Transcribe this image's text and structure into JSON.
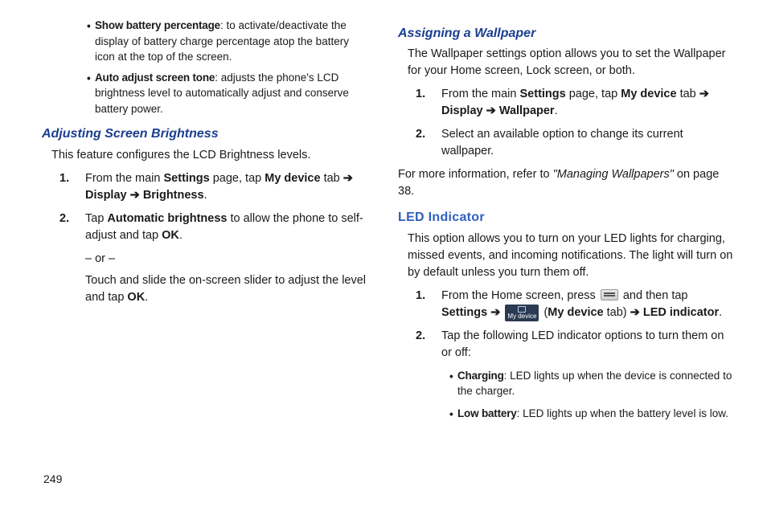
{
  "pageNumber": "249",
  "left": {
    "bullets": [
      {
        "lead": "Show battery percentage",
        "rest": ": to activate/deactivate the display of battery charge percentage atop the battery icon at the top of the screen."
      },
      {
        "lead": "Auto adjust screen tone",
        "rest": ": adjusts the phone's LCD brightness level to automatically adjust and conserve battery power."
      }
    ],
    "heading": "Adjusting Screen Brightness",
    "intro": "This feature configures the LCD Brightness levels.",
    "step1": {
      "num": "1.",
      "pre": "From the main ",
      "settings": "Settings",
      "mid1": " page, tap ",
      "mydevice": "My device",
      "mid2": " tab ",
      "arrow1": "➔",
      "display": "Display",
      "arrow2": "➔",
      "brightness": "Brightness",
      "end": "."
    },
    "step2": {
      "num": "2.",
      "pre": "Tap ",
      "auto": "Automatic brightness",
      "mid": " to allow the phone to self-adjust and tap ",
      "ok": "OK",
      "end": "."
    },
    "or": "– or –",
    "altText": {
      "pre": "Touch and slide the on-screen slider to adjust the level and tap ",
      "ok": "OK",
      "end": "."
    }
  },
  "right": {
    "heading1": "Assigning a Wallpaper",
    "intro1": "The Wallpaper settings option allows you to set the Wallpaper for your Home screen, Lock screen, or both.",
    "stepA1": {
      "num": "1.",
      "pre": "From the main ",
      "settings": "Settings",
      "mid1": " page, tap ",
      "mydevice": "My device",
      "mid2": " tab ",
      "arrow1": "➔",
      "display": "Display",
      "arrow2": "➔",
      "wallpaper": "Wallpaper",
      "end": "."
    },
    "stepA2": {
      "num": "2.",
      "text": "Select an available option to change its current wallpaper."
    },
    "xref": {
      "pre": "For more information, refer to ",
      "title": "\"Managing Wallpapers\"",
      "post": " on page 38."
    },
    "heading2": "LED Indicator",
    "intro2": "This option allows you to turn on your LED lights for charging, missed events, and incoming notifications. The light will turn on by default unless you turn them off.",
    "stepB1": {
      "num": "1.",
      "pre": "From the Home screen, press ",
      "menuIconName": "menu-icon",
      "mid1": " and then tap ",
      "settings": "Settings",
      "arrow1": "➔",
      "myDeviceLabel": "My device",
      "mid2": " (",
      "mydeviceBold": "My device",
      "mid3": " tab) ",
      "arrow2": "➔",
      "led": "LED indicator",
      "end": "."
    },
    "stepB2": {
      "num": "2.",
      "text": "Tap the following LED indicator options to turn them on or off:"
    },
    "subBullets": [
      {
        "lead": "Charging",
        "rest": ": LED lights up when the device is connected to the charger."
      },
      {
        "lead": "Low battery",
        "rest": ": LED lights up when the battery level is low."
      }
    ]
  }
}
